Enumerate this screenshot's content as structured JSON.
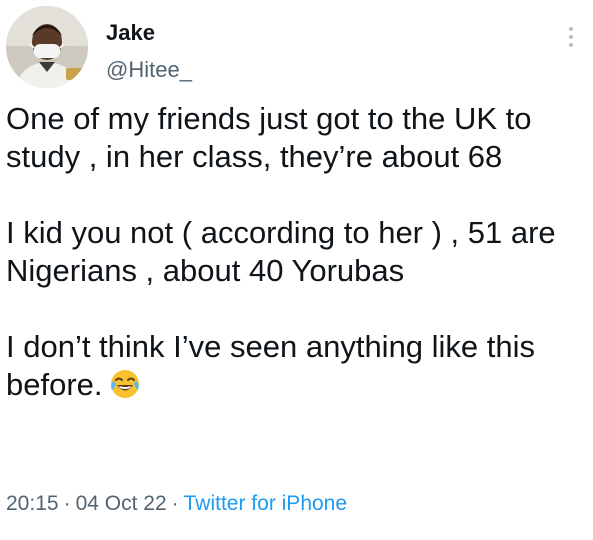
{
  "author": {
    "name": "Jake",
    "handle": "@Hitee_",
    "avatar_icon": "profile-photo-masked-man"
  },
  "more_icon": "vertical-ellipsis-icon",
  "tweet": {
    "paragraphs": [
      "One of my friends just got to the UK to study , in her class, they’re about 68",
      "I kid you not ( according to her ) , 51 are Nigerians , about 40 Yorubas",
      "I don’t think I’ve seen anything like this before."
    ],
    "emoji": "face-with-tears-of-joy"
  },
  "meta": {
    "time": "20:15",
    "separator": "·",
    "date": "04 Oct 22",
    "source": "Twitter for iPhone"
  },
  "colors": {
    "text": "#0f1419",
    "secondary": "#536471",
    "link": "#1d9bf0",
    "emoji_face": "#f7c22d"
  }
}
